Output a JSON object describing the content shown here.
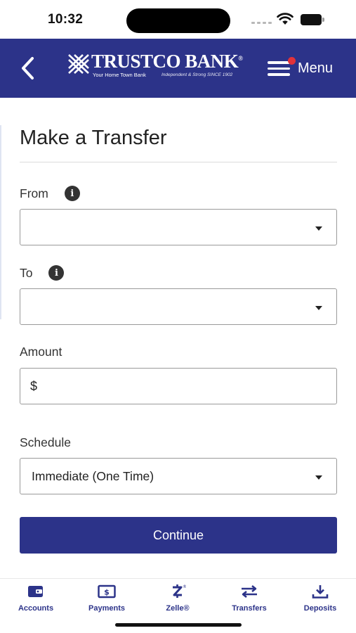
{
  "status_bar": {
    "time": "10:32"
  },
  "header": {
    "logo_name": "TRUSTCO BANK",
    "logo_registered": "®",
    "logo_tagline": "Your Home Town Bank",
    "logo_tagline2": "Independent & Strong SINCE 1902",
    "menu_label": "Menu",
    "brand_color": "#2c3389",
    "notify_color": "#e2323a"
  },
  "form": {
    "title": "Make a Transfer",
    "from": {
      "label": "From",
      "value": ""
    },
    "to": {
      "label": "To",
      "value": ""
    },
    "amount": {
      "label": "Amount",
      "prefix": "$",
      "value": ""
    },
    "schedule": {
      "label": "Schedule",
      "value": "Immediate (One Time)"
    },
    "continue_label": "Continue"
  },
  "bottom_nav": {
    "items": [
      {
        "label": "Accounts",
        "icon": "wallet-icon"
      },
      {
        "label": "Payments",
        "icon": "bill-icon"
      },
      {
        "label": "Zelle®",
        "icon": "zelle-icon"
      },
      {
        "label": "Transfers",
        "icon": "transfer-arrows-icon"
      },
      {
        "label": "Deposits",
        "icon": "download-icon"
      }
    ]
  }
}
